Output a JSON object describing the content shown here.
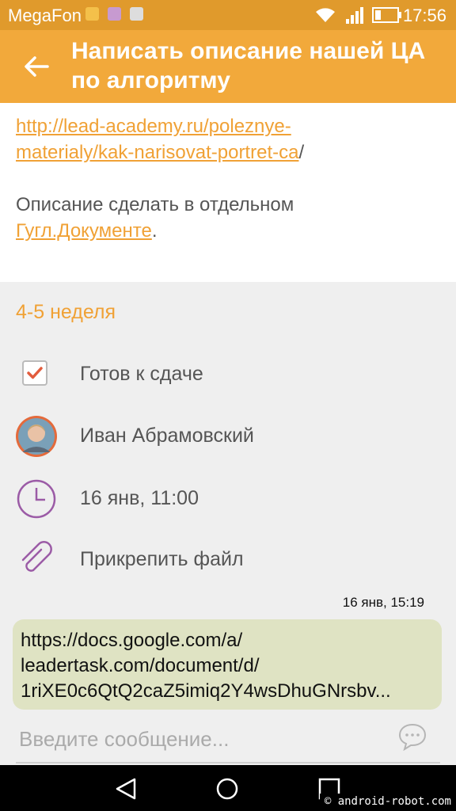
{
  "status_bar": {
    "carrier": "MegaFon",
    "time": "17:56",
    "icons": [
      "notification-1-icon",
      "image-notification-icon",
      "mail-notification-icon",
      "wifi-icon",
      "signal-icon",
      "battery-icon"
    ]
  },
  "header": {
    "title": "Написать описание нашей ЦА по алгоритму",
    "back_icon": "back-arrow-icon"
  },
  "description": {
    "link_line1": "http://lead-academy.ru/poleznye-",
    "link_line2": "materialy/kak-narisovat-portret-ca",
    "link_suffix": "/",
    "text": "Описание сделать в отдельном",
    "doc_link": "Гугл.Документе",
    "text_end": "."
  },
  "task": {
    "week": "4-5 неделя",
    "checkbox_label": "Готов к сдаче",
    "checkbox_checked": true,
    "assignee": "Иван Абрамовский",
    "due": "16 янв, 11:00",
    "attach": "Прикрепить файл"
  },
  "message": {
    "time": "16 янв, 15:19",
    "line1": "https://docs.google.com/a/",
    "line2": "leadertask.com/document/d/",
    "line3": "1riXE0c6QtQ2caZ5imiq2Y4wsDhuGNrsbv..."
  },
  "composer": {
    "placeholder": "Введите сообщение..."
  },
  "watermark": "© android-robot.com",
  "colors": {
    "accent": "#f0a135",
    "appbar": "#f2a93b",
    "statusbar": "#e09a2c",
    "icon": "#9b5ba6",
    "check": "#e25c3d",
    "bubble": "#dfe3c3"
  }
}
